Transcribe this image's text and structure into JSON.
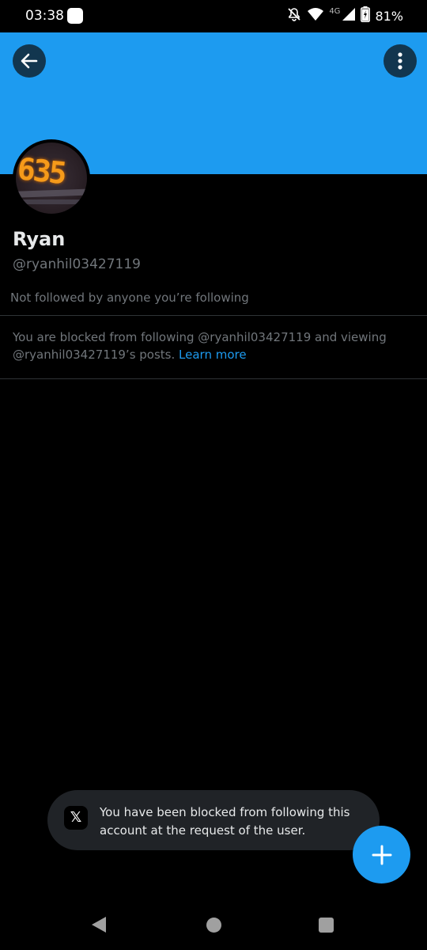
{
  "status_bar": {
    "time": "03:38",
    "signal_label": "4G",
    "battery_pct": "81%",
    "icons": [
      "notifications-off-icon",
      "wifi-icon",
      "cell-signal-icon",
      "battery-charging-icon"
    ]
  },
  "header": {
    "banner_color": "#1d9bf0",
    "back_icon": "arrow-left-icon",
    "more_icon": "vertical-ellipsis-icon"
  },
  "profile": {
    "avatar_text": "635",
    "name": "Ryan",
    "handle": "@ryanhil03427119",
    "followed_by": "Not followed by anyone you’re following"
  },
  "blocked_notice": {
    "text": "You are blocked from following @ryanhil03427119 and viewing @ryanhil03427119’s posts.",
    "link": "Learn more"
  },
  "toast": {
    "icon": "x-logo-icon",
    "icon_glyph": "𝕏",
    "message": "You have been blocked from following this account at the request of the user."
  },
  "fab": {
    "icon": "plus-icon"
  },
  "nav_bar": {
    "items": [
      "back-triangle-icon",
      "home-circle-icon",
      "recents-square-icon"
    ]
  },
  "colors": {
    "accent": "#1d9bf0",
    "background": "#000000",
    "secondary_text": "#71767b"
  }
}
